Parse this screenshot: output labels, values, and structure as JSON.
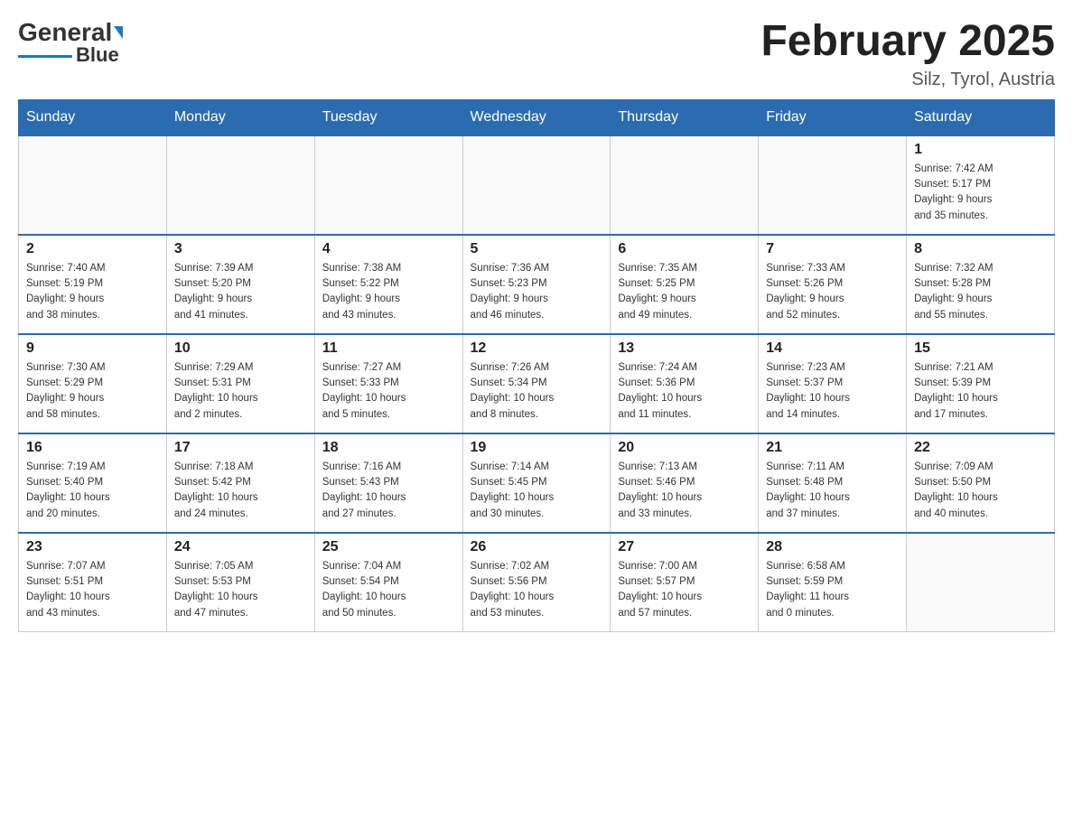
{
  "header": {
    "logo_text_general": "General",
    "logo_text_blue": "Blue",
    "month_title": "February 2025",
    "location": "Silz, Tyrol, Austria"
  },
  "weekdays": [
    "Sunday",
    "Monday",
    "Tuesday",
    "Wednesday",
    "Thursday",
    "Friday",
    "Saturday"
  ],
  "weeks": [
    [
      {
        "day": "",
        "info": ""
      },
      {
        "day": "",
        "info": ""
      },
      {
        "day": "",
        "info": ""
      },
      {
        "day": "",
        "info": ""
      },
      {
        "day": "",
        "info": ""
      },
      {
        "day": "",
        "info": ""
      },
      {
        "day": "1",
        "info": "Sunrise: 7:42 AM\nSunset: 5:17 PM\nDaylight: 9 hours\nand 35 minutes."
      }
    ],
    [
      {
        "day": "2",
        "info": "Sunrise: 7:40 AM\nSunset: 5:19 PM\nDaylight: 9 hours\nand 38 minutes."
      },
      {
        "day": "3",
        "info": "Sunrise: 7:39 AM\nSunset: 5:20 PM\nDaylight: 9 hours\nand 41 minutes."
      },
      {
        "day": "4",
        "info": "Sunrise: 7:38 AM\nSunset: 5:22 PM\nDaylight: 9 hours\nand 43 minutes."
      },
      {
        "day": "5",
        "info": "Sunrise: 7:36 AM\nSunset: 5:23 PM\nDaylight: 9 hours\nand 46 minutes."
      },
      {
        "day": "6",
        "info": "Sunrise: 7:35 AM\nSunset: 5:25 PM\nDaylight: 9 hours\nand 49 minutes."
      },
      {
        "day": "7",
        "info": "Sunrise: 7:33 AM\nSunset: 5:26 PM\nDaylight: 9 hours\nand 52 minutes."
      },
      {
        "day": "8",
        "info": "Sunrise: 7:32 AM\nSunset: 5:28 PM\nDaylight: 9 hours\nand 55 minutes."
      }
    ],
    [
      {
        "day": "9",
        "info": "Sunrise: 7:30 AM\nSunset: 5:29 PM\nDaylight: 9 hours\nand 58 minutes."
      },
      {
        "day": "10",
        "info": "Sunrise: 7:29 AM\nSunset: 5:31 PM\nDaylight: 10 hours\nand 2 minutes."
      },
      {
        "day": "11",
        "info": "Sunrise: 7:27 AM\nSunset: 5:33 PM\nDaylight: 10 hours\nand 5 minutes."
      },
      {
        "day": "12",
        "info": "Sunrise: 7:26 AM\nSunset: 5:34 PM\nDaylight: 10 hours\nand 8 minutes."
      },
      {
        "day": "13",
        "info": "Sunrise: 7:24 AM\nSunset: 5:36 PM\nDaylight: 10 hours\nand 11 minutes."
      },
      {
        "day": "14",
        "info": "Sunrise: 7:23 AM\nSunset: 5:37 PM\nDaylight: 10 hours\nand 14 minutes."
      },
      {
        "day": "15",
        "info": "Sunrise: 7:21 AM\nSunset: 5:39 PM\nDaylight: 10 hours\nand 17 minutes."
      }
    ],
    [
      {
        "day": "16",
        "info": "Sunrise: 7:19 AM\nSunset: 5:40 PM\nDaylight: 10 hours\nand 20 minutes."
      },
      {
        "day": "17",
        "info": "Sunrise: 7:18 AM\nSunset: 5:42 PM\nDaylight: 10 hours\nand 24 minutes."
      },
      {
        "day": "18",
        "info": "Sunrise: 7:16 AM\nSunset: 5:43 PM\nDaylight: 10 hours\nand 27 minutes."
      },
      {
        "day": "19",
        "info": "Sunrise: 7:14 AM\nSunset: 5:45 PM\nDaylight: 10 hours\nand 30 minutes."
      },
      {
        "day": "20",
        "info": "Sunrise: 7:13 AM\nSunset: 5:46 PM\nDaylight: 10 hours\nand 33 minutes."
      },
      {
        "day": "21",
        "info": "Sunrise: 7:11 AM\nSunset: 5:48 PM\nDaylight: 10 hours\nand 37 minutes."
      },
      {
        "day": "22",
        "info": "Sunrise: 7:09 AM\nSunset: 5:50 PM\nDaylight: 10 hours\nand 40 minutes."
      }
    ],
    [
      {
        "day": "23",
        "info": "Sunrise: 7:07 AM\nSunset: 5:51 PM\nDaylight: 10 hours\nand 43 minutes."
      },
      {
        "day": "24",
        "info": "Sunrise: 7:05 AM\nSunset: 5:53 PM\nDaylight: 10 hours\nand 47 minutes."
      },
      {
        "day": "25",
        "info": "Sunrise: 7:04 AM\nSunset: 5:54 PM\nDaylight: 10 hours\nand 50 minutes."
      },
      {
        "day": "26",
        "info": "Sunrise: 7:02 AM\nSunset: 5:56 PM\nDaylight: 10 hours\nand 53 minutes."
      },
      {
        "day": "27",
        "info": "Sunrise: 7:00 AM\nSunset: 5:57 PM\nDaylight: 10 hours\nand 57 minutes."
      },
      {
        "day": "28",
        "info": "Sunrise: 6:58 AM\nSunset: 5:59 PM\nDaylight: 11 hours\nand 0 minutes."
      },
      {
        "day": "",
        "info": ""
      }
    ]
  ]
}
